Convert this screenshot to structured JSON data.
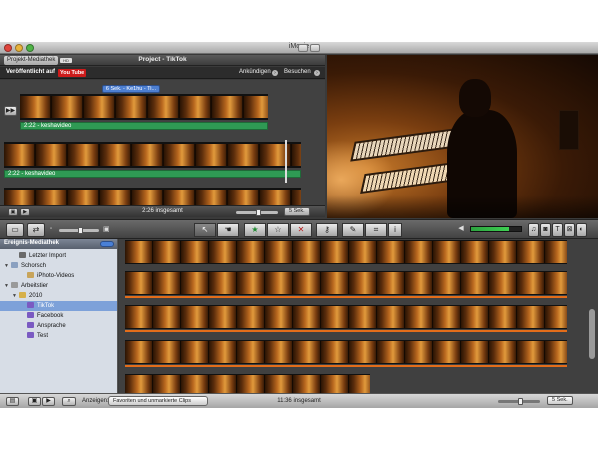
{
  "window": {
    "title": "iMovie"
  },
  "project_header": {
    "library_tab": "Projekt-Mediathek",
    "hd_badge": "HD",
    "project_title": "Project - TikTok"
  },
  "publish_bar": {
    "published_label": "Veröffentlicht auf",
    "service_badge": "You Tube",
    "announce_label": "Ankündigen",
    "visit_label": "Besuchen"
  },
  "project": {
    "title_clip": "6 Sek. - Ke1hu - Ti...",
    "clip_label_1": "2:22 - keshavideo",
    "clip_label_2": "2:22 - keshavideo",
    "total": "2:26 insgesamt",
    "seconds_label": "5 Sek."
  },
  "toolbar": {
    "tools": [
      {
        "name": "arrow-tool",
        "glyph": "↖"
      },
      {
        "name": "hand-tool",
        "glyph": "☚"
      },
      {
        "name": "favorite-star",
        "glyph": "★"
      },
      {
        "name": "unmark-star",
        "glyph": "☆"
      },
      {
        "name": "reject-x",
        "glyph": "✕"
      },
      {
        "name": "keyword-key",
        "glyph": "⚷"
      },
      {
        "name": "dropper-tool",
        "glyph": "✎"
      },
      {
        "name": "crop-tool",
        "glyph": "⌗"
      },
      {
        "name": "info-button",
        "glyph": "i"
      }
    ],
    "audio_level": 0.75,
    "right_icons": [
      "♫",
      "◙",
      "T",
      "⊠",
      "◐"
    ]
  },
  "events": {
    "title": "Ereignis-Mediathek",
    "items": [
      {
        "label": "Letzter Import",
        "icon": "film-icon",
        "indent": 1,
        "expand": "",
        "selected": false
      },
      {
        "label": "Schorsch",
        "icon": "computer-icon",
        "indent": 0,
        "expand": "▼",
        "selected": false
      },
      {
        "label": "iPhoto-Videos",
        "icon": "photo-icon",
        "indent": 2,
        "expand": "",
        "selected": false
      },
      {
        "label": "Arbeitstier",
        "icon": "drive-icon",
        "indent": 0,
        "expand": "▼",
        "selected": false
      },
      {
        "label": "2010",
        "icon": "folder-icon",
        "indent": 1,
        "expand": "▼",
        "selected": false
      },
      {
        "label": "TikTok",
        "icon": "event-icon",
        "indent": 2,
        "expand": "",
        "selected": true
      },
      {
        "label": "Facebook",
        "icon": "event-icon",
        "indent": 2,
        "expand": "",
        "selected": false
      },
      {
        "label": "Ansprache",
        "icon": "event-icon",
        "indent": 2,
        "expand": "",
        "selected": false
      },
      {
        "label": "Test",
        "icon": "event-icon",
        "indent": 2,
        "expand": "",
        "selected": false
      }
    ]
  },
  "bottombar": {
    "show_label": "Anzeigen:",
    "filter_value": "Favoriten und unmarkierte Clips",
    "total": "11:36 insgesamt",
    "seconds_label": "5 Sek."
  },
  "colors": {
    "clip_green": "#2f9a54",
    "title_blue": "#4d7fd1",
    "selection": "#7da1d9",
    "used_orange": "#e36d1a"
  }
}
